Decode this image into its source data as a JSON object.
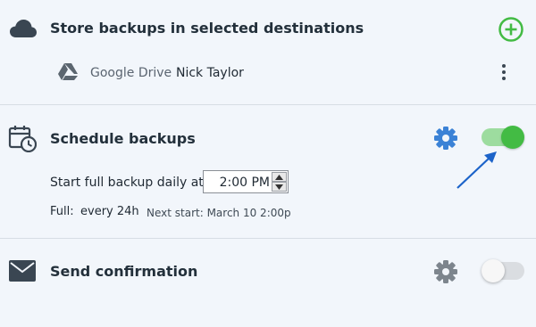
{
  "destinations": {
    "title": "Store backups in selected destinations",
    "items": [
      {
        "service": "Google Drive",
        "account": "Nick Taylor",
        "icon": "google-drive-icon"
      }
    ],
    "add_icon": "plus-circle-icon",
    "menu_icon": "vertical-dots-icon",
    "accent": "#43bb44"
  },
  "schedule": {
    "title": "Schedule backups",
    "enabled": true,
    "start_label": "Start full backup daily at",
    "time_value": "2:00 PM",
    "full_label": "Full:",
    "full_value": "every 24h",
    "next_start": "Next start: March 10 2:00p",
    "settings_icon": "gear-icon",
    "icon": "calendar-clock-icon",
    "settings_color": "#3b82d6"
  },
  "confirmation": {
    "title": "Send confirmation",
    "enabled": false,
    "icon": "envelope-icon",
    "settings_icon": "gear-icon"
  }
}
